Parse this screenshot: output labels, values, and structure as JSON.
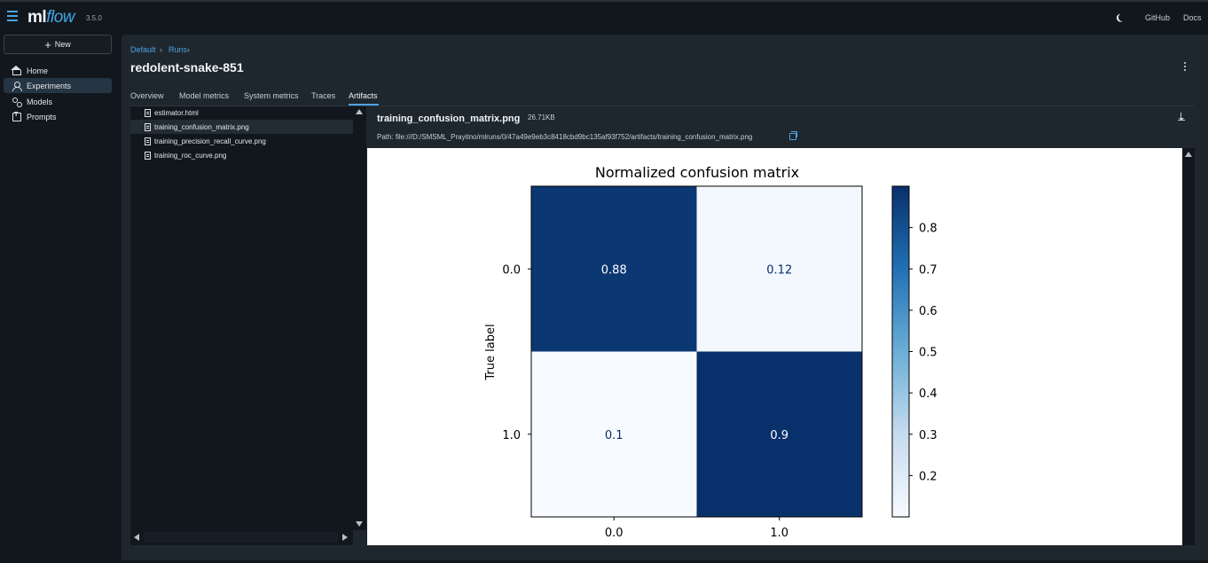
{
  "header": {
    "logo_ml": "ml",
    "logo_flow": "flow",
    "version": "3.5.0",
    "links": {
      "github": "GitHub",
      "docs": "Docs"
    }
  },
  "sidebar": {
    "new_label": "New",
    "items": [
      {
        "label": "Home",
        "icon": "home-icon",
        "active": false
      },
      {
        "label": "Experiments",
        "icon": "experiments-icon",
        "active": true
      },
      {
        "label": "Models",
        "icon": "models-icon",
        "active": false
      },
      {
        "label": "Prompts",
        "icon": "prompts-icon",
        "active": false
      }
    ]
  },
  "breadcrumb": {
    "items": [
      "Default",
      "Runs"
    ],
    "separator": "›"
  },
  "run": {
    "title": "redolent-snake-851"
  },
  "tabs": [
    {
      "label": "Overview",
      "active": false
    },
    {
      "label": "Model metrics",
      "active": false
    },
    {
      "label": "System metrics",
      "active": false
    },
    {
      "label": "Traces",
      "active": false
    },
    {
      "label": "Artifacts",
      "active": true
    }
  ],
  "files": [
    {
      "name": "estimator.html",
      "selected": false
    },
    {
      "name": "training_confusion_matrix.png",
      "selected": true
    },
    {
      "name": "training_precision_recall_curve.png",
      "selected": false
    },
    {
      "name": "training_roc_curve.png",
      "selected": false
    }
  ],
  "artifact": {
    "name": "training_confusion_matrix.png",
    "size": "26.71KB",
    "path": "Path: file:///D:/SMSML_Prayitno/mlruns/0/47a49e9eb3c8418cbd9bc135af93f752/artifacts/training_confusion_matrix.png"
  },
  "colors": {
    "accent": "#4da3e6",
    "cell_dark": "#08306b",
    "cell_light": "#f2f7fd"
  },
  "chart_data": {
    "type": "heatmap",
    "title": "Normalized confusion matrix",
    "ylabel": "True label",
    "xlabel": "",
    "x_categories": [
      "0.0",
      "1.0"
    ],
    "y_categories": [
      "0.0",
      "1.0"
    ],
    "values": [
      [
        0.88,
        0.12
      ],
      [
        0.1,
        0.9
      ]
    ],
    "value_labels": [
      [
        "0.88",
        "0.12"
      ],
      [
        "0.1",
        "0.9"
      ]
    ],
    "colorbar": {
      "range": [
        0.1,
        0.9
      ],
      "ticks": [
        0.2,
        0.3,
        0.4,
        0.5,
        0.6,
        0.7,
        0.8
      ],
      "tick_labels": [
        "0.2",
        "0.3",
        "0.4",
        "0.5",
        "0.6",
        "0.7",
        "0.8"
      ],
      "colormap": "Blues"
    }
  }
}
